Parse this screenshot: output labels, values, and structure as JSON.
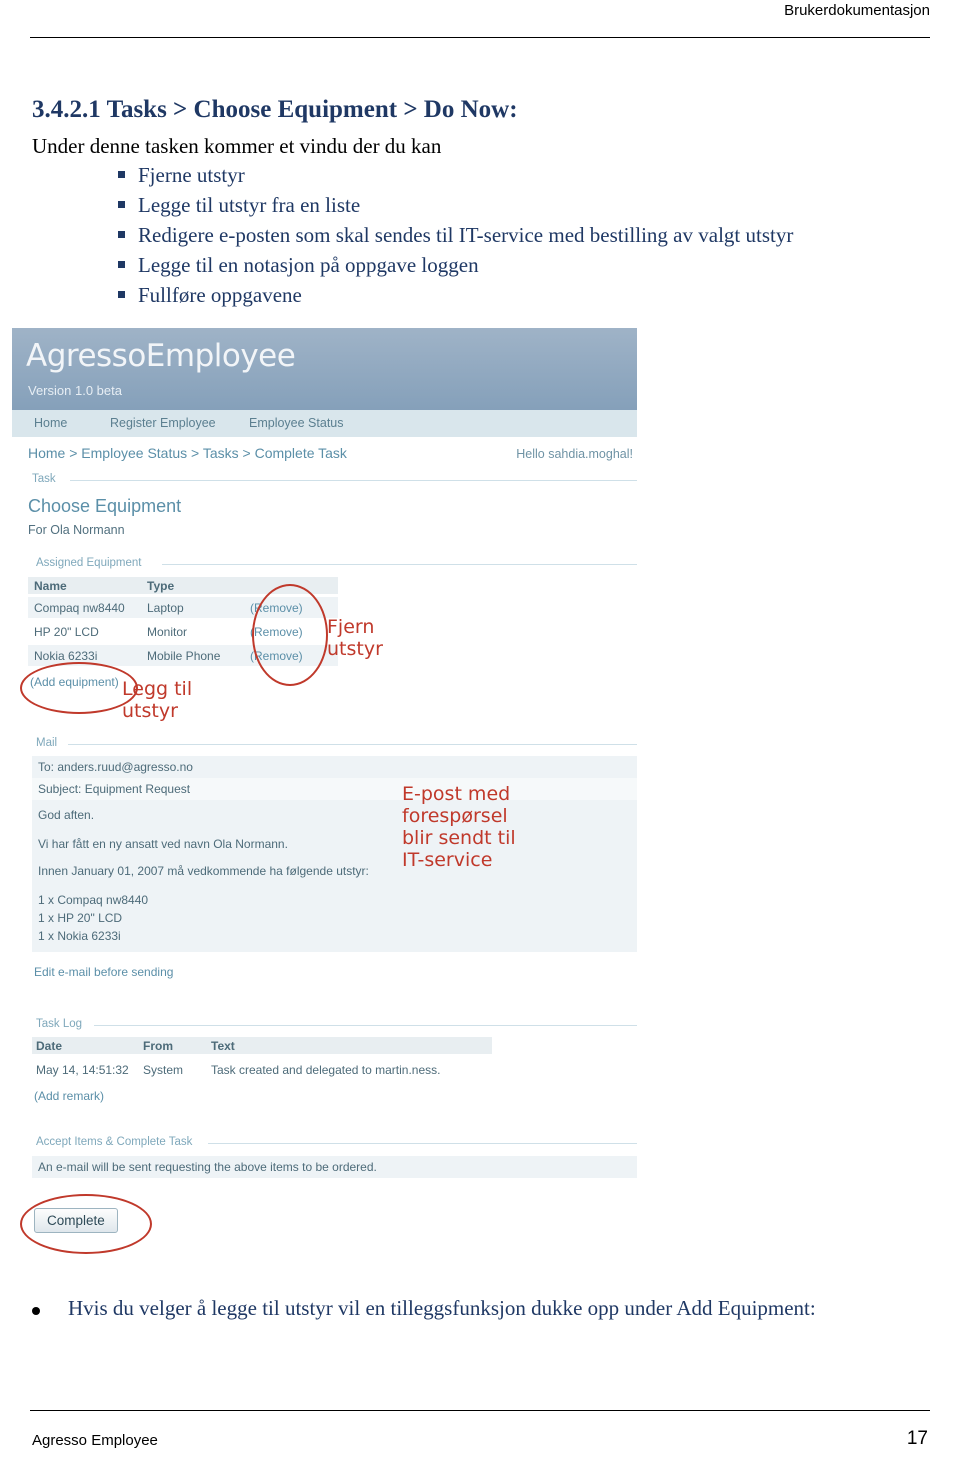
{
  "header": {
    "running_head": "Brukerdokumentasjon"
  },
  "section": {
    "number": "3.4.2.1",
    "title": "Tasks > Choose Equipment > Do Now:",
    "intro": "Under denne tasken kommer et vindu der du kan",
    "bullets": [
      "Fjerne utstyr",
      "Legge til utstyr fra en liste",
      "Redigere e-posten som skal sendes til IT-service med bestilling av valgt utstyr",
      "Legge til en notasjon på oppgave loggen",
      "Fullføre oppgavene"
    ]
  },
  "screenshot": {
    "app_title": "AgressoEmployee",
    "version": "Version 1.0 beta",
    "nav": [
      "Home",
      "Register Employee",
      "Employee Status"
    ],
    "breadcrumb": "Home > Employee Status > Tasks > Complete Task",
    "greeting": "Hello sahdia.moghal!",
    "task_group_label": "Task",
    "task_title": "Choose Equipment",
    "task_for": "For Ola Normann",
    "assigned_label": "Assigned Equipment",
    "equipment_headers": [
      "Name",
      "Type",
      ""
    ],
    "equipment_rows": [
      {
        "name": "Compaq nw8440",
        "type": "Laptop",
        "action": "(Remove)"
      },
      {
        "name": "HP 20\" LCD",
        "type": "Monitor",
        "action": "(Remove)"
      },
      {
        "name": "Nokia 6233i",
        "type": "Mobile Phone",
        "action": "(Remove)"
      }
    ],
    "add_equipment_link": "(Add equipment)",
    "mail_label": "Mail",
    "mail_to": "To: anders.ruud@agresso.no",
    "mail_subject": "Subject: Equipment Request",
    "mail_body": [
      "God aften.",
      "Vi har fått en ny ansatt ved navn Ola Normann.",
      "Innen January 01, 2007 må vedkommende ha følgende utstyr:",
      "1 x Compaq nw8440",
      "1 x HP 20\" LCD",
      "1 x Nokia 6233i"
    ],
    "edit_mail_link": "Edit e-mail before sending",
    "task_log_label": "Task Log",
    "log_headers": [
      "Date",
      "From",
      "Text"
    ],
    "log_rows": [
      {
        "date": "May 14, 14:51:32",
        "from": "System",
        "text": "Task created and delegated to martin.ness."
      }
    ],
    "add_remark_link": "(Add remark)",
    "accept_label": "Accept Items & Complete Task",
    "accept_note": "An e-mail will be sent requesting the above items to be ordered.",
    "complete_button": "Complete",
    "annotations": [
      {
        "id": "fjern-utstyr",
        "text": "Fjern\nutstyr"
      },
      {
        "id": "legg-til-utstyr",
        "text": "Legg til\nutstyr"
      },
      {
        "id": "epost-it-service",
        "text": "E-post med\nforespørsel\nblir sendt til\nIT-service"
      }
    ]
  },
  "bottom_note": "Hvis du velger å legge til utstyr vil en tilleggsfunksjon dukke opp under Add Equipment:",
  "footer": {
    "left": "Agresso Employee",
    "right": "17"
  },
  "colors": {
    "heading": "#1f3864",
    "annotation": "#c0392b",
    "banner": "#8fa8c0"
  }
}
